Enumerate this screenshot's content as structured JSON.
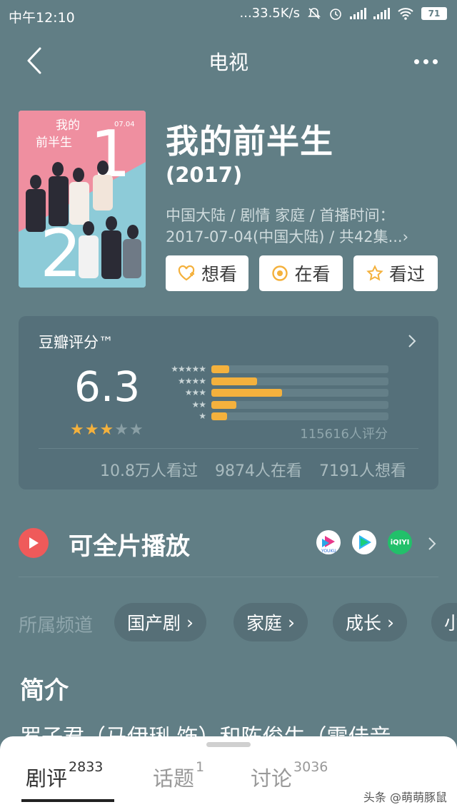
{
  "status_bar": {
    "time": "中午12:10",
    "network_speed": "...33.5K/s",
    "battery": "71"
  },
  "nav": {
    "title": "电视"
  },
  "movie": {
    "title": "我的前半生",
    "year": "(2017)",
    "meta_line1": "中国大陆 / 剧情 家庭 / 首播时间：",
    "meta_line2": "2017-07-04(中国大陆) / 共42集...›",
    "poster": {
      "title_text": "我的前半生",
      "date_text": "07.04",
      "numbers": [
        "1",
        "2"
      ],
      "colors": {
        "pink": "#ef8fa0",
        "teal": "#8dcbd8"
      }
    }
  },
  "actions": [
    {
      "label": "想看",
      "icon": "heart-plus-icon"
    },
    {
      "label": "在看",
      "icon": "circle-dot-icon"
    },
    {
      "label": "看过",
      "icon": "star-outline-icon"
    }
  ],
  "rating": {
    "label": "豆瓣评分™",
    "score": "6.3",
    "stars": 3,
    "star_max": 5,
    "distribution": [
      {
        "stars": "★★★★★",
        "fraction": 0.1
      },
      {
        "stars": "★★★★",
        "fraction": 0.26
      },
      {
        "stars": "★★★",
        "fraction": 0.4
      },
      {
        "stars": "★★",
        "fraction": 0.14
      },
      {
        "stars": "★",
        "fraction": 0.09
      }
    ],
    "count": "115616人评分",
    "watched": "10.8万人看过",
    "watching": "9874人在看",
    "want": "7191人想看",
    "accent": "#f4b13d"
  },
  "play": {
    "label": "可全片播放",
    "platforms": [
      {
        "name": "YOUKU",
        "icon": "youku-icon"
      },
      {
        "name": "",
        "icon": "tencent-video-icon"
      },
      {
        "name": "iQIYI",
        "icon": "iqiyi-icon"
      }
    ]
  },
  "channels": {
    "label": "所属频道",
    "items": [
      "国产剧",
      "家庭",
      "成长",
      "小"
    ]
  },
  "summary": {
    "heading": "简介",
    "text": "罗子君（马伊琍 饰）和陈俊生（雷佳音"
  },
  "bottom_tabs": [
    {
      "label": "剧评",
      "count": "2833"
    },
    {
      "label": "话题",
      "count": "1"
    },
    {
      "label": "讨论",
      "count": "3036"
    }
  ],
  "watermark": "头条 @萌萌豚鼠"
}
